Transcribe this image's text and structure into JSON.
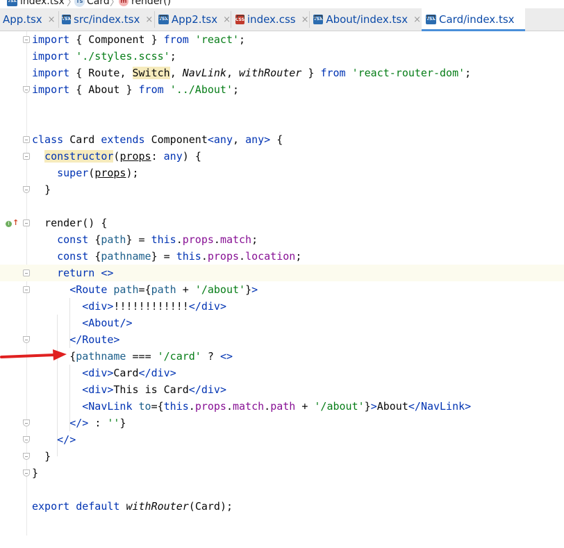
{
  "breadcrumb": [
    {
      "label": "index.tsx",
      "icon": "tsx-file-icon"
    },
    {
      "label": "Card",
      "icon": "typescript-class-icon"
    },
    {
      "label": "render()",
      "icon": "method-icon"
    }
  ],
  "tabs": [
    {
      "label": "App.tsx",
      "icon": "",
      "active": false
    },
    {
      "label": "src/index.tsx",
      "icon": "tsx-file-icon",
      "active": false
    },
    {
      "label": "App2.tsx",
      "icon": "tsx-file-icon",
      "active": false
    },
    {
      "label": "index.css",
      "icon": "css-file-icon",
      "active": false
    },
    {
      "label": "About/index.tsx",
      "icon": "tsx-file-icon",
      "active": false
    },
    {
      "label": "Card/index.tsx",
      "icon": "tsx-file-icon",
      "active": true
    }
  ],
  "tab_close": "×",
  "gutter_marker": "↑",
  "code_lines": [
    "import { Component } from 'react';",
    "import './styles.scss';",
    "import { Route, Switch, NavLink, withRouter } from 'react-router-dom';",
    "import { About } from '../About';",
    "",
    "",
    "class Card extends Component<any, any> {",
    "  constructor(props: any) {",
    "    super(props);",
    "  }",
    "",
    "  render() {",
    "    const {path} = this.props.match;",
    "    const {pathname} = this.props.location;",
    "    return <>",
    "      <Route path={path + '/about'}>",
    "        <div>!!!!!!!!!!!!</div>",
    "        <About/>",
    "      </Route>",
    "      {pathname === '/card' ? <>",
    "        <div>Card</div>",
    "        <div>This is Card</div>",
    "        <NavLink to={this.props.match.path + '/about'}>About</NavLink>",
    "      </> : ''}",
    "    </>",
    "  }",
    "}",
    "",
    "export default withRouter(Card);"
  ],
  "colors": {
    "keyword": "#0033b3",
    "string": "#067d17",
    "property": "#871094",
    "annotation_arrow": "#e02020"
  }
}
